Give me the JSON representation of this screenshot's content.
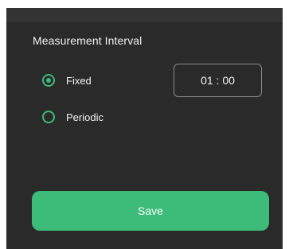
{
  "colors": {
    "panel_background": "#2a2a2a",
    "accent": "#3dbb78",
    "text": "#f2f2f2"
  },
  "section": {
    "title": "Measurement Interval"
  },
  "options": [
    {
      "label": "Fixed",
      "selected": true
    },
    {
      "label": "Periodic",
      "selected": false
    }
  ],
  "time_field": {
    "value": "01 : 00"
  },
  "save_button": {
    "label": "Save"
  }
}
